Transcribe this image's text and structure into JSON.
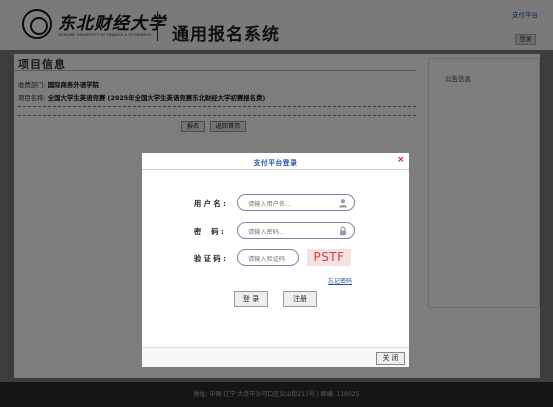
{
  "header": {
    "logo_cn": "东北财经大学",
    "logo_en": "DONGBEI UNIVERSITY OF FINANCE & ECONOMICS",
    "system_title": "通用报名系统",
    "top_link": "支付平台",
    "login_label": "登录"
  },
  "main": {
    "section_title": "项目信息",
    "dept_label": "收费部门:",
    "dept_value": "国际商务外语学院",
    "project_label": "项目名称:",
    "project_value": "全国大学生英语竞赛 (2025年全国大学生英语竞赛东北财经大学初赛报名费)",
    "signup_button": "报名",
    "back_button": "返回首页"
  },
  "sidebar": {
    "notice_title": "公告信息"
  },
  "footer": {
    "address": "地址: 中国·辽宁·大连市沙河口区尖山街217号 | 邮编: 116025"
  },
  "modal": {
    "title": "支付平台登录",
    "close_icon": "×",
    "username_label": "用 户 名 :",
    "username_placeholder": "请输入用户名...",
    "password_label": "密    码 :",
    "password_placeholder": "请输入密码...",
    "captcha_label": "验 证 码 :",
    "captcha_placeholder": "请输入验证码",
    "captcha_text": "PSTF",
    "forgot_link": "忘记密码",
    "login_button": "登 录",
    "register_button": "注册",
    "close_button": "关 闭"
  },
  "colors": {
    "accent_blue": "#2a4fa8",
    "captcha_red": "#e23a3a",
    "close_red": "#d42020"
  }
}
